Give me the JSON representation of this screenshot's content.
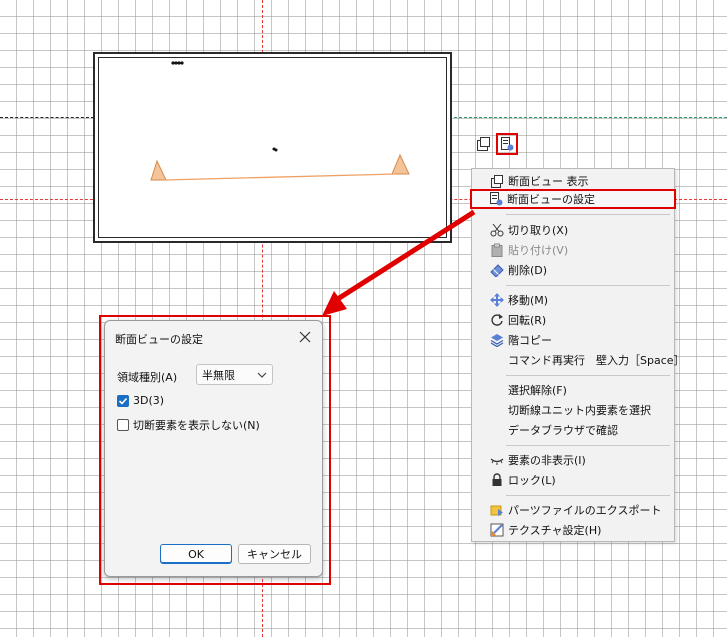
{
  "context_menu": {
    "items": [
      {
        "label": "断面ビュー 表示",
        "icon": "section-view-show-icon",
        "disabled": false
      },
      {
        "label": "断面ビューの設定",
        "icon": "section-view-settings-icon",
        "disabled": false,
        "highlighted": true
      },
      {
        "label": "切り取り(X)",
        "icon": "scissors-icon",
        "disabled": false
      },
      {
        "label": "貼り付け(V)",
        "icon": "clipboard-icon",
        "disabled": true
      },
      {
        "label": "削除(D)",
        "icon": "eraser-icon",
        "disabled": false
      },
      {
        "label": "移動(M)",
        "icon": "move-icon",
        "disabled": false
      },
      {
        "label": "回転(R)",
        "icon": "rotate-icon",
        "disabled": false
      },
      {
        "label": "階コピー",
        "icon": "layers-icon",
        "disabled": false
      },
      {
        "label": "コマンド再実行　壁入力［Space］",
        "icon": "",
        "disabled": false
      },
      {
        "label": "選択解除(F)",
        "icon": "",
        "disabled": false
      },
      {
        "label": "切断線ユニット内要素を選択",
        "icon": "",
        "disabled": false
      },
      {
        "label": "データブラウザで確認",
        "icon": "",
        "disabled": false
      },
      {
        "label": "要素の非表示(I)",
        "icon": "eye-closed-icon",
        "disabled": false
      },
      {
        "label": "ロック(L)",
        "icon": "lock-icon",
        "disabled": false
      },
      {
        "label": "パーツファイルのエクスポート",
        "icon": "export-icon",
        "disabled": false
      },
      {
        "label": "テクスチャ設定(H)",
        "icon": "texture-icon",
        "disabled": false
      }
    ]
  },
  "dialog": {
    "title": "断面ビューの設定",
    "area_type_label": "領域種別(A)",
    "area_type_value": "半無限",
    "checkbox_3d_label": "3D(3)",
    "checkbox_3d_checked": true,
    "checkbox_hide_label": "切断要素を表示しない(N)",
    "checkbox_hide_checked": false,
    "ok_label": "OK",
    "cancel_label": "キャンセル"
  },
  "colors": {
    "highlight": "#e00000",
    "grid_axis": "#e53935",
    "ground_line": "#f0b070",
    "checkbox_accent": "#1a6fc4"
  }
}
